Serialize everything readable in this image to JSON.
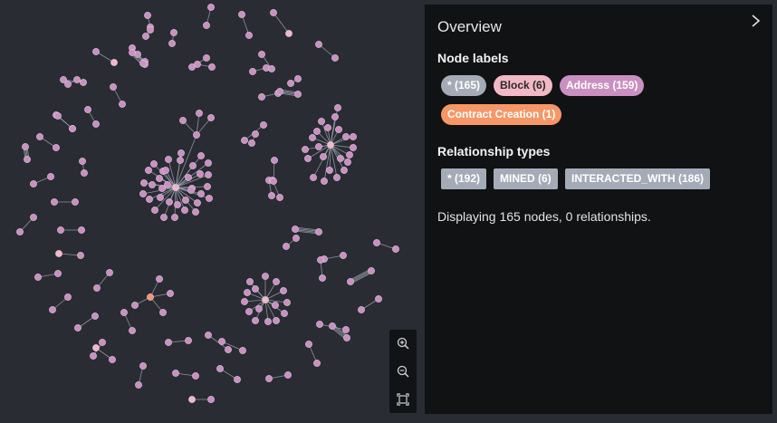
{
  "overview": {
    "title": "Overview",
    "node_labels_title": "Node labels",
    "node_labels": [
      {
        "label": "* (165)",
        "color": "#a5abb6",
        "text_color": "#ffffff"
      },
      {
        "label": "Block (6)",
        "color": "#f2b8c6",
        "text_color": "#2a2a2a"
      },
      {
        "label": "Address (159)",
        "color": "#c990c0",
        "text_color": "#ffffff"
      },
      {
        "label": "Contract Creation (1)",
        "color": "#f79767",
        "text_color": "#ffffff"
      }
    ],
    "relationship_types_title": "Relationship types",
    "relationship_types": [
      {
        "label": "* (192)"
      },
      {
        "label": "MINED (6)"
      },
      {
        "label": "INTERACTED_WITH (186)"
      }
    ],
    "status": "Displaying 165 nodes, 0 relationships."
  },
  "graph": {
    "node_color": "#c990c0",
    "node_stroke": "#b27db0",
    "block_color": "#f2b8c6",
    "contract_color": "#f79767",
    "edge_color": "#a5abb6",
    "background": "#2a2c34"
  },
  "controls": {
    "zoom_in": "zoom-in-icon",
    "zoom_out": "zoom-out-icon",
    "fit": "fit-to-screen-icon"
  }
}
